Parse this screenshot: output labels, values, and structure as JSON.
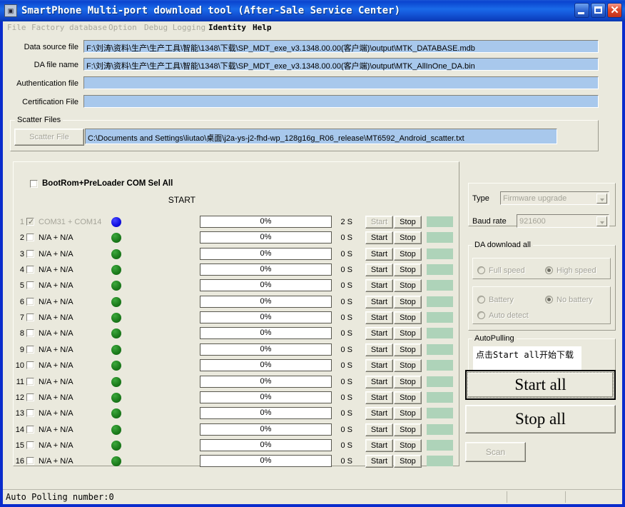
{
  "window": {
    "title": "SmartPhone Multi-port download tool (After-Sale Service Center)",
    "icon": "app-icon",
    "minimize_label": "_",
    "maximize_label": "",
    "close_label": "✕"
  },
  "menubar": {
    "items": [
      {
        "label": "File",
        "enabled": false
      },
      {
        "label": "Factory database",
        "enabled": false
      },
      {
        "label": "Option",
        "enabled": false
      },
      {
        "label": "Debug Logging",
        "enabled": false
      },
      {
        "label": "Identity",
        "enabled": true
      },
      {
        "label": "Help",
        "enabled": true
      }
    ]
  },
  "files": {
    "rows": [
      {
        "label": "Data source file",
        "value": "F:\\刘涛\\资料\\生产\\生产工具\\智能\\1348\\下载\\SP_MDT_exe_v3.1348.00.00(客户端)\\output\\MTK_DATABASE.mdb"
      },
      {
        "label": "DA file name",
        "value": "F:\\刘涛\\资料\\生产\\生产工具\\智能\\1348\\下载\\SP_MDT_exe_v3.1348.00.00(客户端)\\output\\MTK_AllInOne_DA.bin"
      },
      {
        "label": "Authentication file",
        "value": ""
      },
      {
        "label": "Certification File",
        "value": ""
      }
    ]
  },
  "scatter": {
    "legend": "Scatter Files",
    "button_label": "Scatter File",
    "button_enabled": false,
    "value": "C:\\Documents and Settings\\liutao\\桌面\\j2a-ys-j2-fhd-wp_128g16g_R06_release\\MT6592_Android_scatter.txt"
  },
  "ports": {
    "select_all_label": "BootRom+PreLoader COM Sel All",
    "select_all_checked": false,
    "start_label": "START",
    "start_button_label": "Start",
    "stop_button_label": "Stop",
    "rows": [
      {
        "num": "1",
        "com": "COM31 + COM14",
        "checked": true,
        "enabled": false,
        "led": "blue",
        "progress": "0%",
        "seconds": "2 S",
        "start_enabled": false
      },
      {
        "num": "2",
        "com": "N/A + N/A",
        "checked": false,
        "enabled": true,
        "led": "green",
        "progress": "0%",
        "seconds": "0 S",
        "start_enabled": true
      },
      {
        "num": "3",
        "com": "N/A + N/A",
        "checked": false,
        "enabled": true,
        "led": "green",
        "progress": "0%",
        "seconds": "0 S",
        "start_enabled": true
      },
      {
        "num": "4",
        "com": "N/A + N/A",
        "checked": false,
        "enabled": true,
        "led": "green",
        "progress": "0%",
        "seconds": "0 S",
        "start_enabled": true
      },
      {
        "num": "5",
        "com": "N/A + N/A",
        "checked": false,
        "enabled": true,
        "led": "green",
        "progress": "0%",
        "seconds": "0 S",
        "start_enabled": true
      },
      {
        "num": "6",
        "com": "N/A + N/A",
        "checked": false,
        "enabled": true,
        "led": "green",
        "progress": "0%",
        "seconds": "0 S",
        "start_enabled": true
      },
      {
        "num": "7",
        "com": "N/A + N/A",
        "checked": false,
        "enabled": true,
        "led": "green",
        "progress": "0%",
        "seconds": "0 S",
        "start_enabled": true
      },
      {
        "num": "8",
        "com": "N/A + N/A",
        "checked": false,
        "enabled": true,
        "led": "green",
        "progress": "0%",
        "seconds": "0 S",
        "start_enabled": true
      },
      {
        "num": "9",
        "com": "N/A + N/A",
        "checked": false,
        "enabled": true,
        "led": "green",
        "progress": "0%",
        "seconds": "0 S",
        "start_enabled": true
      },
      {
        "num": "10",
        "com": "N/A + N/A",
        "checked": false,
        "enabled": true,
        "led": "green",
        "progress": "0%",
        "seconds": "0 S",
        "start_enabled": true
      },
      {
        "num": "11",
        "com": "N/A + N/A",
        "checked": false,
        "enabled": true,
        "led": "green",
        "progress": "0%",
        "seconds": "0 S",
        "start_enabled": true
      },
      {
        "num": "12",
        "com": "N/A + N/A",
        "checked": false,
        "enabled": true,
        "led": "green",
        "progress": "0%",
        "seconds": "0 S",
        "start_enabled": true
      },
      {
        "num": "13",
        "com": "N/A + N/A",
        "checked": false,
        "enabled": true,
        "led": "green",
        "progress": "0%",
        "seconds": "0 S",
        "start_enabled": true
      },
      {
        "num": "14",
        "com": "N/A + N/A",
        "checked": false,
        "enabled": true,
        "led": "green",
        "progress": "0%",
        "seconds": "0 S",
        "start_enabled": true
      },
      {
        "num": "15",
        "com": "N/A + N/A",
        "checked": false,
        "enabled": true,
        "led": "green",
        "progress": "0%",
        "seconds": "0 S",
        "start_enabled": true
      },
      {
        "num": "16",
        "com": "N/A + N/A",
        "checked": false,
        "enabled": true,
        "led": "green",
        "progress": "0%",
        "seconds": "0 S",
        "start_enabled": true
      }
    ]
  },
  "settings": {
    "type_label": "Type",
    "type_value": "Firmware upgrade",
    "baud_label": "Baud rate",
    "baud_value": "921600"
  },
  "da_download": {
    "legend": "DA download all",
    "speed": [
      {
        "label": "Full speed",
        "selected": false
      },
      {
        "label": "High speed",
        "selected": true
      }
    ],
    "battery": [
      {
        "label": "Battery",
        "selected": false
      },
      {
        "label": "No battery",
        "selected": true
      },
      {
        "label": "Auto detect",
        "selected": false
      }
    ]
  },
  "autopulling": {
    "legend": "AutoPulling",
    "message": "点击Start all开始下载"
  },
  "actions": {
    "start_all": "Start all",
    "stop_all": "Stop all",
    "scan": "Scan",
    "scan_enabled": false
  },
  "statusbar": {
    "text": "Auto Polling number:0"
  },
  "colors": {
    "titlebar": "#0a44cf",
    "window_bg": "#eae9dd",
    "field_bg": "#a8c8ec",
    "led_green": "#1d7d1d",
    "led_blue": "#1414e4",
    "status_box": "#aed3b9",
    "close_button": "#e04a29"
  }
}
